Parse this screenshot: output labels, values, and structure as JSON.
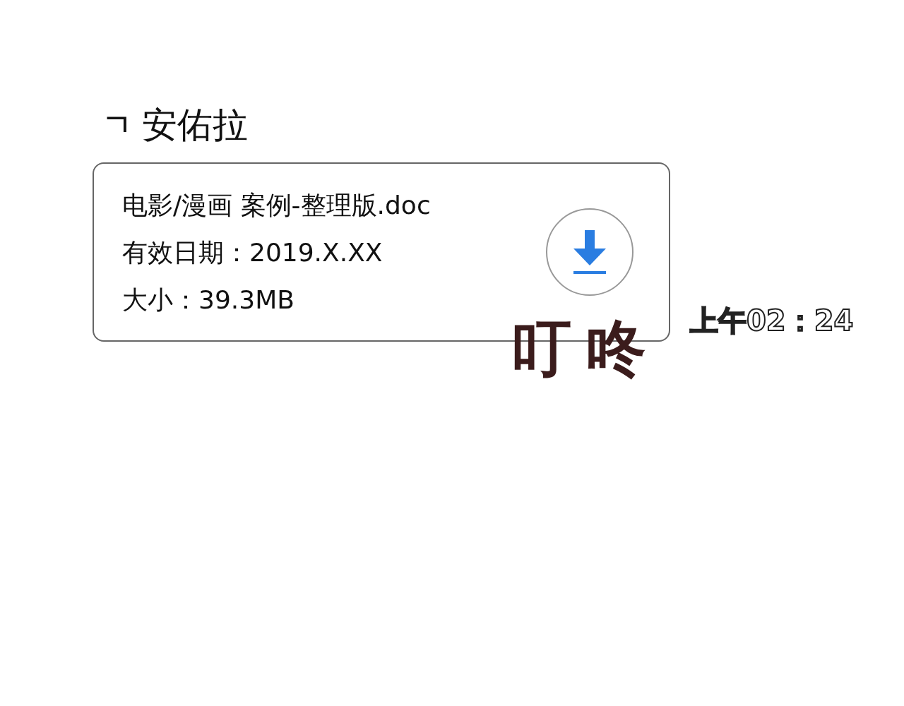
{
  "sender": {
    "mark": "ㄱ",
    "name": "安佑拉"
  },
  "file_message": {
    "filename": "电影/漫画 案例-整理版.doc",
    "expiry": "有效日期：2019.X.XX",
    "size": "大小：39.3MB"
  },
  "sound_effect": "叮咚",
  "time": "上午02：24"
}
